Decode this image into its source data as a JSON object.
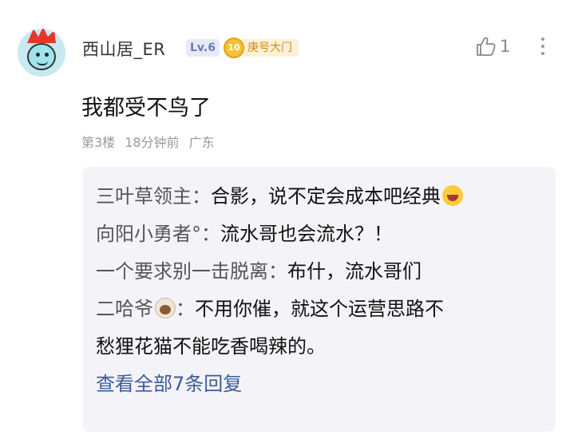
{
  "comment": {
    "username": "西山居_ER",
    "level": "Lv.6",
    "badge_medal": "10",
    "badge_text": "庚号大门",
    "like_count": "1",
    "text": "我都受不鸟了",
    "floor": "第3楼",
    "time": "18分钟前",
    "location": "广东"
  },
  "replies": [
    {
      "name": "三叶草领主：",
      "text": "合影，说不定会成本吧经典",
      "emoji": "laughing-emoji"
    },
    {
      "name": "向阳小勇者°：",
      "text": "流水哥也会流水？！"
    },
    {
      "name": "一个要求别一击脱离：",
      "text": "布什，流水哥们"
    },
    {
      "name": "二哈爷",
      "emoji": "dog-emoji",
      "sep": "：",
      "text": "不用你催，就这个运营思路不"
    },
    {
      "name": "",
      "text": "愁狸花猫不能吃香喝辣的。"
    }
  ],
  "view_all": "查看全部7条回复",
  "icons": {
    "like": "thumbs-up-icon",
    "more": "more-vertical-icon"
  }
}
